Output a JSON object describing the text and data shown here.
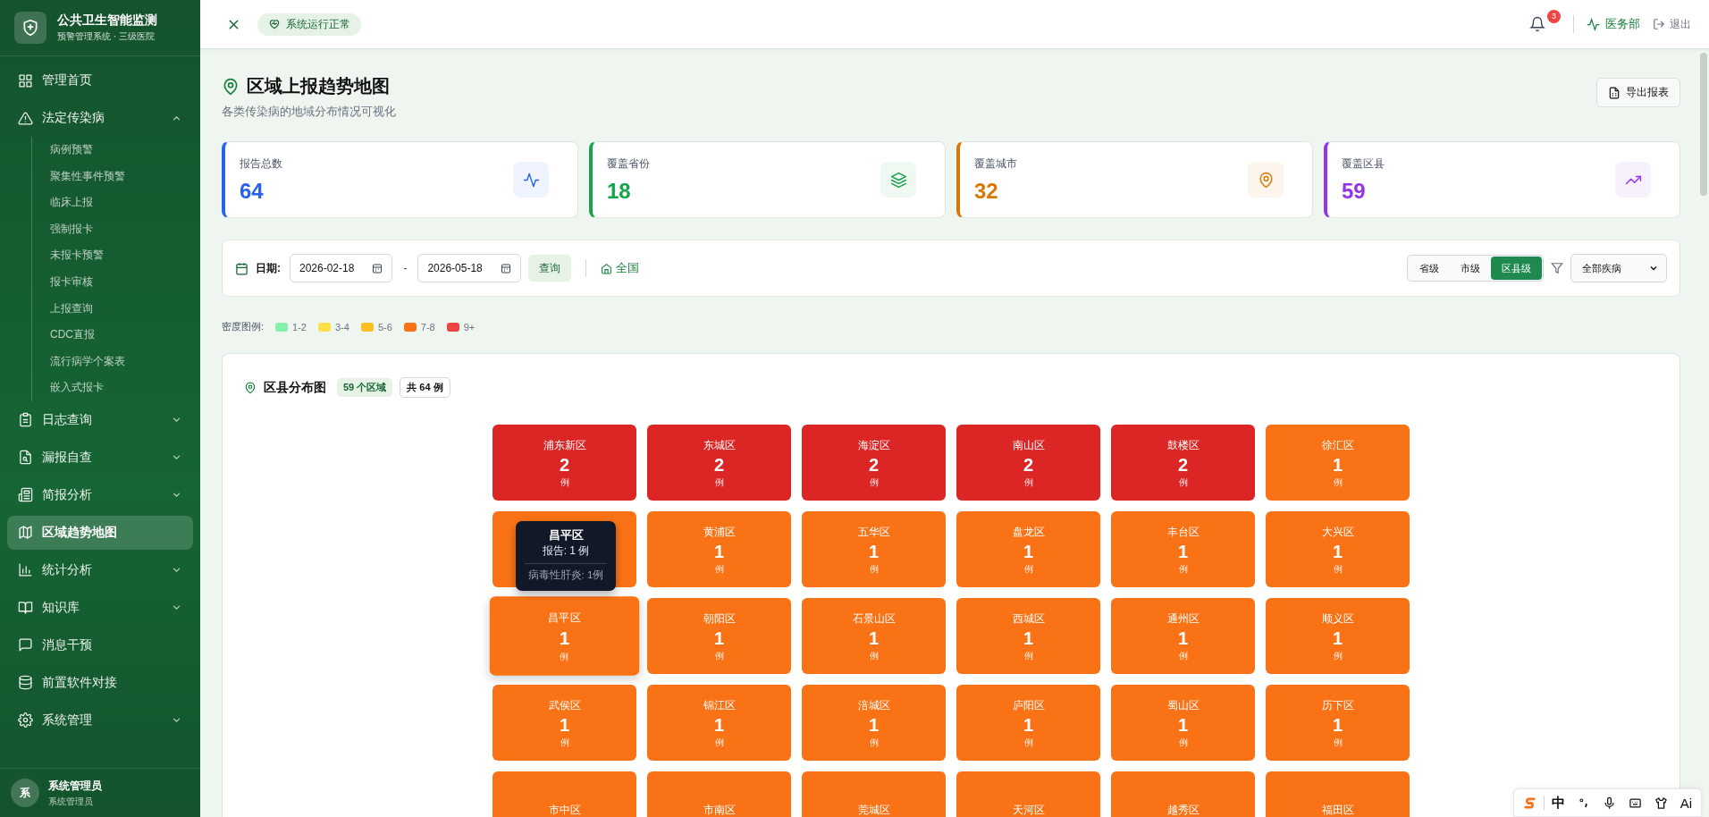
{
  "sidebar": {
    "title": "公共卫生智能监测",
    "subtitle": "预警管理系统 · 三级医院",
    "items": [
      {
        "kind": "item",
        "label": "管理首页",
        "selected": false
      },
      {
        "kind": "group",
        "label": "法定传染病",
        "expanded": true,
        "selected": false,
        "children": [
          {
            "label": "病例预警"
          },
          {
            "label": "聚集性事件预警"
          },
          {
            "label": "临床上报"
          },
          {
            "label": "强制报卡"
          },
          {
            "label": "未报卡预警"
          },
          {
            "label": "报卡审核"
          },
          {
            "label": "上报查询"
          },
          {
            "label": "CDC直报"
          },
          {
            "label": "流行病学个案表"
          },
          {
            "label": "嵌入式报卡"
          }
        ]
      },
      {
        "kind": "group",
        "label": "日志查询",
        "expanded": false,
        "selected": false
      },
      {
        "kind": "group",
        "label": "漏报自查",
        "expanded": false,
        "selected": false
      },
      {
        "kind": "group",
        "label": "简报分析",
        "expanded": false,
        "selected": false
      },
      {
        "kind": "item",
        "label": "区域趋势地图",
        "selected": true
      },
      {
        "kind": "group",
        "label": "统计分析",
        "expanded": false,
        "selected": false
      },
      {
        "kind": "group",
        "label": "知识库",
        "expanded": false,
        "selected": false
      },
      {
        "kind": "item",
        "label": "消息干预",
        "selected": false
      },
      {
        "kind": "item",
        "label": "前置软件对接",
        "selected": false
      },
      {
        "kind": "group",
        "label": "系统管理",
        "expanded": false,
        "selected": false
      }
    ],
    "user": {
      "avatar": "系",
      "name": "系统管理员",
      "role": "系统管理员"
    }
  },
  "header": {
    "status": "系统运行正常",
    "notifications": "3",
    "department": "医务部",
    "logout": "退出"
  },
  "page": {
    "title": "区域上报趋势地图",
    "subtitle": "各类传染病的地域分布情况可视化",
    "export": "导出报表"
  },
  "stats": [
    {
      "label": "报告总数",
      "value": "64",
      "color": "#2563eb"
    },
    {
      "label": "覆盖省份",
      "value": "18",
      "color": "#16a34a"
    },
    {
      "label": "覆盖城市",
      "value": "32",
      "color": "#d97706"
    },
    {
      "label": "覆盖区县",
      "value": "59",
      "color": "#9333ea"
    }
  ],
  "filters": {
    "date_label": "日期:",
    "start": "2026-02-18",
    "separator": "-",
    "end": "2026-05-18",
    "query": "查询",
    "scope": "全国",
    "levels": [
      {
        "label": "省级",
        "selected": false
      },
      {
        "label": "市级",
        "selected": false
      },
      {
        "label": "区县级",
        "selected": true
      }
    ],
    "disease": "全部疾病"
  },
  "legend": {
    "label": "密度图例:",
    "items": [
      {
        "label": "1-2",
        "color": "#86efac"
      },
      {
        "label": "3-4",
        "color": "#fde047"
      },
      {
        "label": "5-6",
        "color": "#fbbf24"
      },
      {
        "label": "7-8",
        "color": "#f97316"
      },
      {
        "label": "9+",
        "color": "#ef4444"
      }
    ]
  },
  "map": {
    "title": "区县分布图",
    "regions_badge": "59 个区域",
    "total_badge": "共 64 例",
    "tooltip": {
      "title": "昌平区",
      "report": "报告: 1 例",
      "detail": "病毒性肝炎: 1例"
    },
    "cells": [
      {
        "name": "浦东新区",
        "count": "2",
        "unit": "例",
        "color": "#dc2626",
        "hovered": false
      },
      {
        "name": "东城区",
        "count": "2",
        "unit": "例",
        "color": "#dc2626",
        "hovered": false
      },
      {
        "name": "海淀区",
        "count": "2",
        "unit": "例",
        "color": "#dc2626",
        "hovered": false
      },
      {
        "name": "南山区",
        "count": "2",
        "unit": "例",
        "color": "#dc2626",
        "hovered": false
      },
      {
        "name": "鼓楼区",
        "count": "2",
        "unit": "例",
        "color": "#dc2626",
        "hovered": false
      },
      {
        "name": "徐汇区",
        "count": "1",
        "unit": "例",
        "color": "#f97316",
        "hovered": false
      },
      {
        "color": "#f97316",
        "hovered": false
      },
      {
        "name": "黄浦区",
        "count": "1",
        "unit": "例",
        "color": "#f97316",
        "hovered": false
      },
      {
        "name": "五华区",
        "count": "1",
        "unit": "例",
        "color": "#f97316",
        "hovered": false
      },
      {
        "name": "盘龙区",
        "count": "1",
        "unit": "例",
        "color": "#f97316",
        "hovered": false
      },
      {
        "name": "丰台区",
        "count": "1",
        "unit": "例",
        "color": "#f97316",
        "hovered": false
      },
      {
        "name": "大兴区",
        "count": "1",
        "unit": "例",
        "color": "#f97316",
        "hovered": false
      },
      {
        "name": "昌平区",
        "count": "1",
        "unit": "例",
        "color": "#f97316",
        "hovered": true
      },
      {
        "name": "朝阳区",
        "count": "1",
        "unit": "例",
        "color": "#f97316",
        "hovered": false
      },
      {
        "name": "石景山区",
        "count": "1",
        "unit": "例",
        "color": "#f97316",
        "hovered": false
      },
      {
        "name": "西城区",
        "count": "1",
        "unit": "例",
        "color": "#f97316",
        "hovered": false
      },
      {
        "name": "通州区",
        "count": "1",
        "unit": "例",
        "color": "#f97316",
        "hovered": false
      },
      {
        "name": "顺义区",
        "count": "1",
        "unit": "例",
        "color": "#f97316",
        "hovered": false
      },
      {
        "name": "武侯区",
        "count": "1",
        "unit": "例",
        "color": "#f97316",
        "hovered": false
      },
      {
        "name": "锦江区",
        "count": "1",
        "unit": "例",
        "color": "#f97316",
        "hovered": false
      },
      {
        "name": "涪城区",
        "count": "1",
        "unit": "例",
        "color": "#f97316",
        "hovered": false
      },
      {
        "name": "庐阳区",
        "count": "1",
        "unit": "例",
        "color": "#f97316",
        "hovered": false
      },
      {
        "name": "蜀山区",
        "count": "1",
        "unit": "例",
        "color": "#f97316",
        "hovered": false
      },
      {
        "name": "历下区",
        "count": "1",
        "unit": "例",
        "color": "#f97316",
        "hovered": false
      },
      {
        "name": "市中区",
        "color": "#f97316",
        "hovered": false
      },
      {
        "name": "市南区",
        "color": "#f97316",
        "hovered": false
      },
      {
        "name": "莞城区",
        "color": "#f97316",
        "hovered": false
      },
      {
        "name": "天河区",
        "color": "#f97316",
        "hovered": false
      },
      {
        "name": "越秀区",
        "color": "#f97316",
        "hovered": false
      },
      {
        "name": "福田区",
        "color": "#f97316",
        "hovered": false
      }
    ]
  },
  "ime_toolbar": {
    "mode": "中",
    "ai": "Ai"
  }
}
